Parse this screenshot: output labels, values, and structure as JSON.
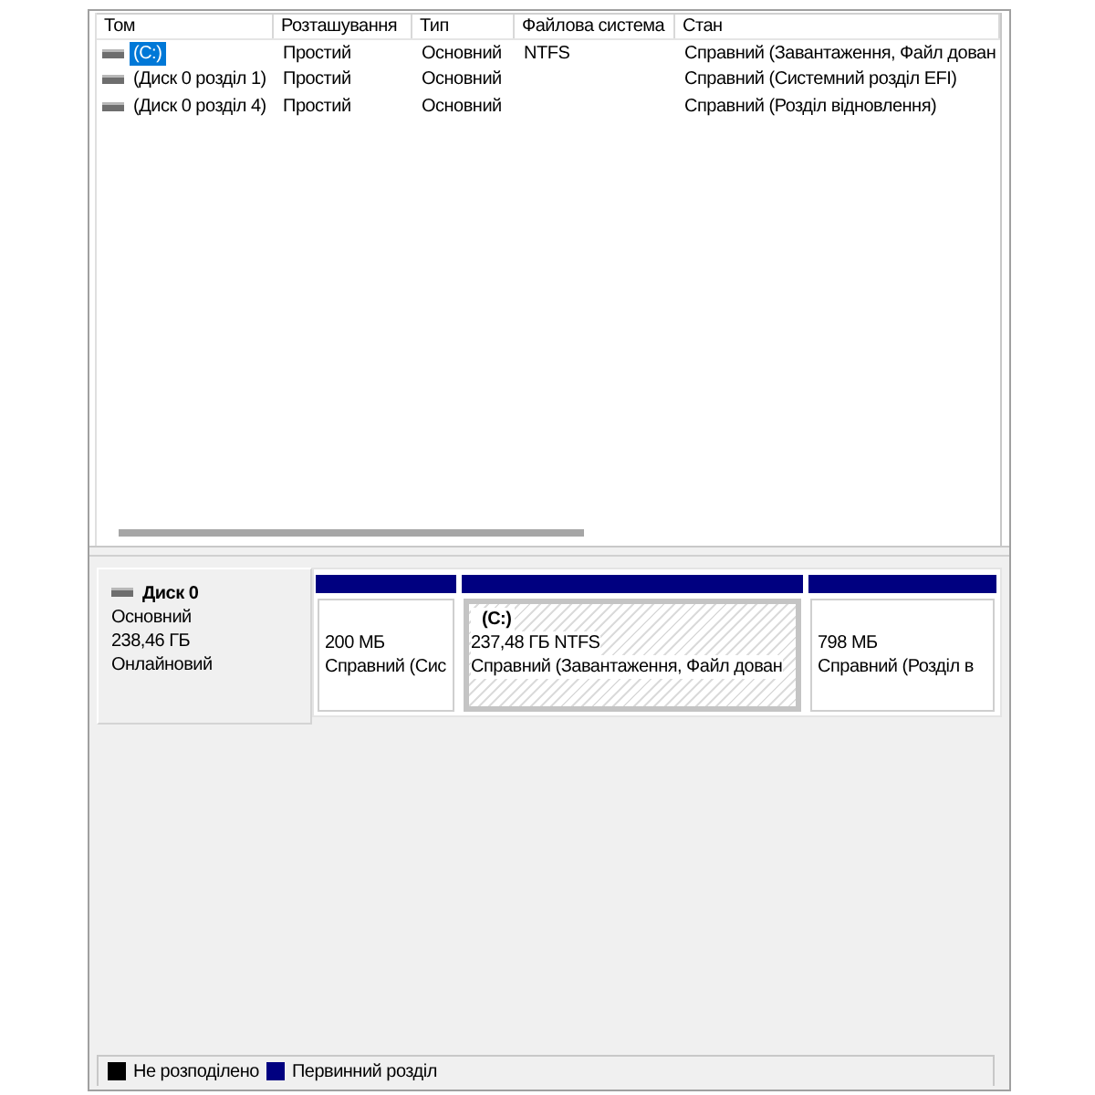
{
  "volume_table": {
    "columns": [
      "Том",
      "Розташування",
      "Тип",
      "Файлова система",
      "Стан"
    ],
    "rows": [
      {
        "volume": "(C:)",
        "layout": "Простий",
        "type": "Основний",
        "file_system": "NTFS",
        "status": "Справний (Завантаження, Файл дован",
        "selected": true
      },
      {
        "volume": "(Диск 0 розділ 1)",
        "layout": "Простий",
        "type": "Основний",
        "status": "Справний (Системний розділ EFI)",
        "selected": false
      },
      {
        "volume": "(Диск 0 розділ 4)",
        "layout": "Простий",
        "type": "Основний",
        "status": "Справний (Розділ відновлення)",
        "selected": false
      }
    ]
  },
  "disks": [
    {
      "name": "Диск 0",
      "type": "Основний",
      "size": "238,46 ГБ",
      "status": "Онлайновий",
      "partitions": [
        {
          "size": "200 МБ",
          "status": "Справний (Сис",
          "selected": false
        },
        {
          "name": "(C:)",
          "size": "237,48 ГБ NTFS",
          "status": "Справний (Завантаження, Файл дован",
          "selected": true
        },
        {
          "size": "798 МБ",
          "status": "Справний (Розділ в",
          "selected": false
        }
      ]
    }
  ],
  "legend": [
    {
      "label": "Не розподілено",
      "color": "#000000"
    },
    {
      "label": "Первинний розділ",
      "color": "#000080"
    }
  ]
}
